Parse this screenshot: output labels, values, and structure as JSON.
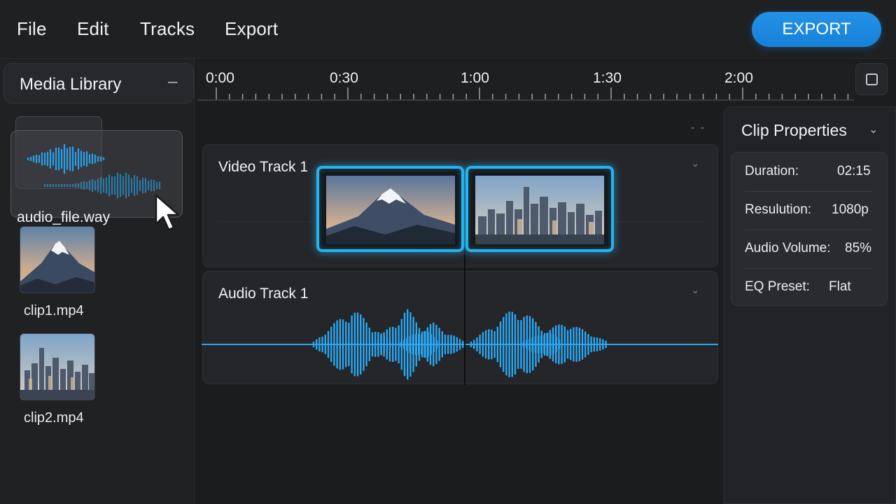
{
  "menu": {
    "items": [
      "File",
      "Edit",
      "Tracks",
      "Export"
    ],
    "export_button": "EXPORT"
  },
  "media_library": {
    "title": "Media Library",
    "collapse_symbol": "–",
    "dragging_item": "audio_file.way",
    "items": [
      {
        "label": "clip1.mp4",
        "thumbnail": "mountain"
      },
      {
        "label": "clip2.mp4",
        "thumbnail": "city"
      }
    ]
  },
  "timeline": {
    "ticks": [
      "0:00",
      "0:30",
      "1:00",
      "1:30",
      "2:00"
    ],
    "zoom_indicator": "- -",
    "tracks": [
      {
        "label": "Video Track 1",
        "clips": [
          "mountain",
          "city"
        ]
      },
      {
        "label": "Audio Track 1"
      }
    ]
  },
  "clip_properties": {
    "title": "Clip Properties",
    "rows": [
      {
        "key": "Duration:",
        "value": "02:15"
      },
      {
        "key": "Resulution:",
        "value": "1080p"
      },
      {
        "key": "Audio Volume:",
        "value": "85%"
      },
      {
        "key": "EQ Preset:",
        "value": "Flat"
      }
    ]
  },
  "colors": {
    "accent": "#1a86df",
    "clip_highlight": "#23b3f0",
    "waveform": "#2aa7f2",
    "background": "#1c1d1f"
  }
}
